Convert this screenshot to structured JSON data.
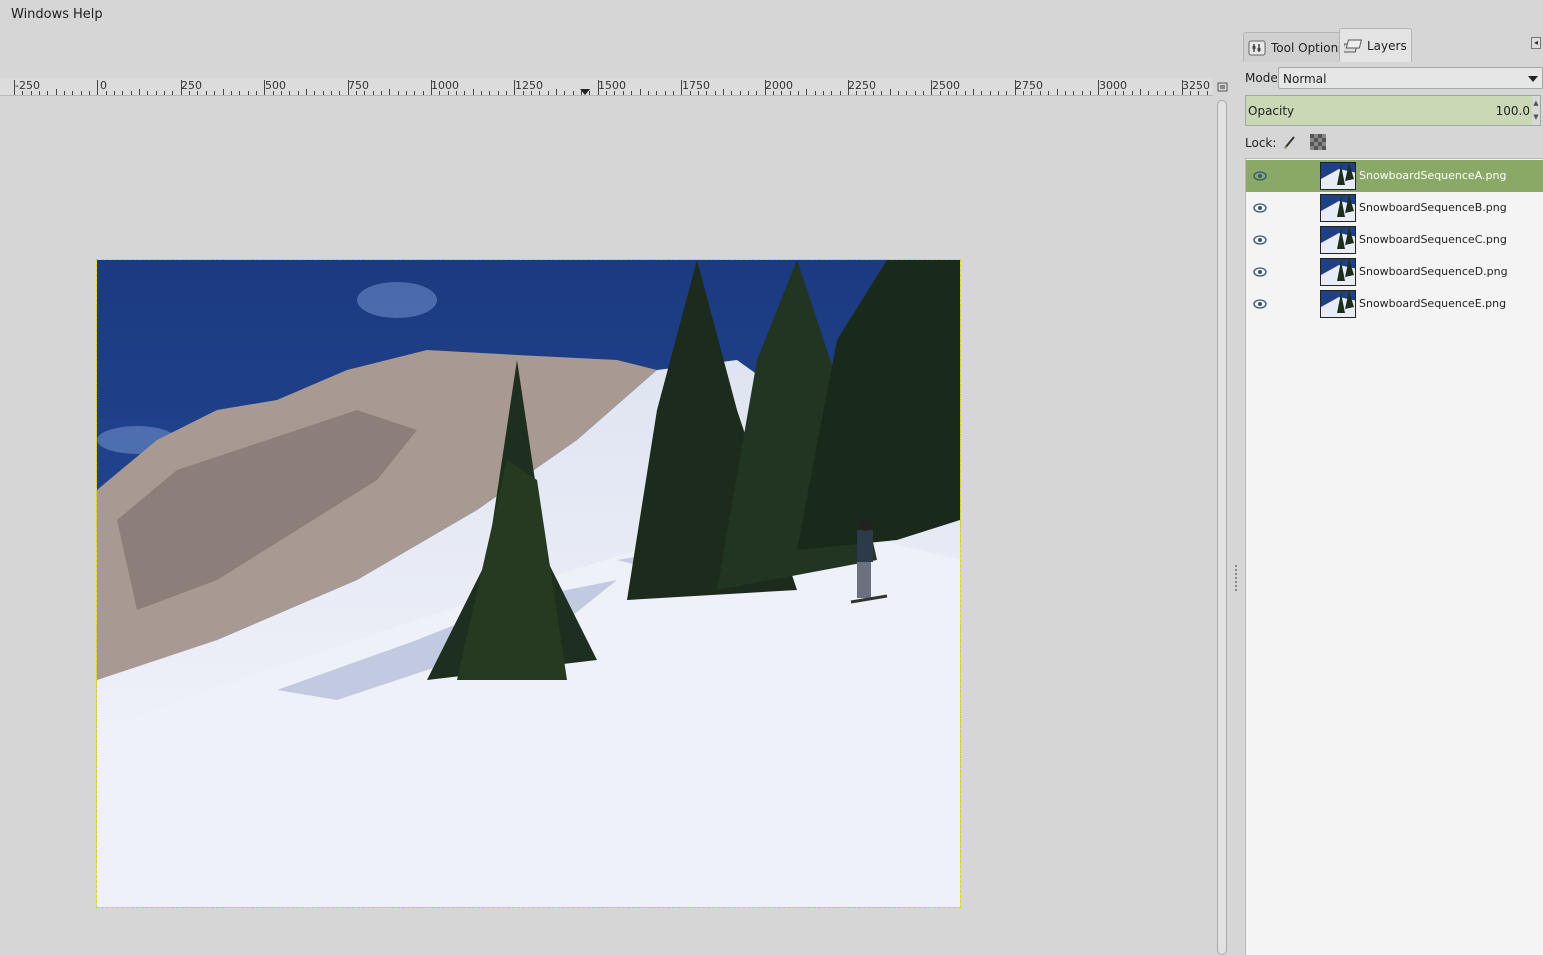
{
  "menubar": {
    "items": [
      {
        "label": "Windows"
      },
      {
        "label": "Help"
      }
    ]
  },
  "ruler": {
    "labels": [
      "-250",
      "0",
      "250",
      "500",
      "750",
      "1000",
      "1250",
      "1500",
      "1750",
      "2000",
      "2250",
      "2500",
      "2750",
      "3000",
      "3250"
    ]
  },
  "canvas": {
    "image_description_icon": "snowboard-photo"
  },
  "panel": {
    "tabs": [
      {
        "label": "Tool Options",
        "icon": "tool-options-icon",
        "active": false
      },
      {
        "label": "Layers",
        "icon": "layers-icon",
        "active": true
      }
    ],
    "mode_label": "Mode:",
    "mode_value": "Normal",
    "opacity_label": "Opacity",
    "opacity_value": "100.0",
    "lock_label": "Lock:",
    "layers": [
      {
        "name": "SnowboardSequenceA.png",
        "visible": true,
        "selected": true
      },
      {
        "name": "SnowboardSequenceB.png",
        "visible": true,
        "selected": false
      },
      {
        "name": "SnowboardSequenceC.png",
        "visible": true,
        "selected": false
      },
      {
        "name": "SnowboardSequenceD.png",
        "visible": true,
        "selected": false
      },
      {
        "name": "SnowboardSequenceE.png",
        "visible": true,
        "selected": false
      }
    ]
  },
  "colors": {
    "selected_layer": "#8aa966",
    "opacity_fill": "#cbd8b6",
    "sky": "#1e3f86"
  }
}
